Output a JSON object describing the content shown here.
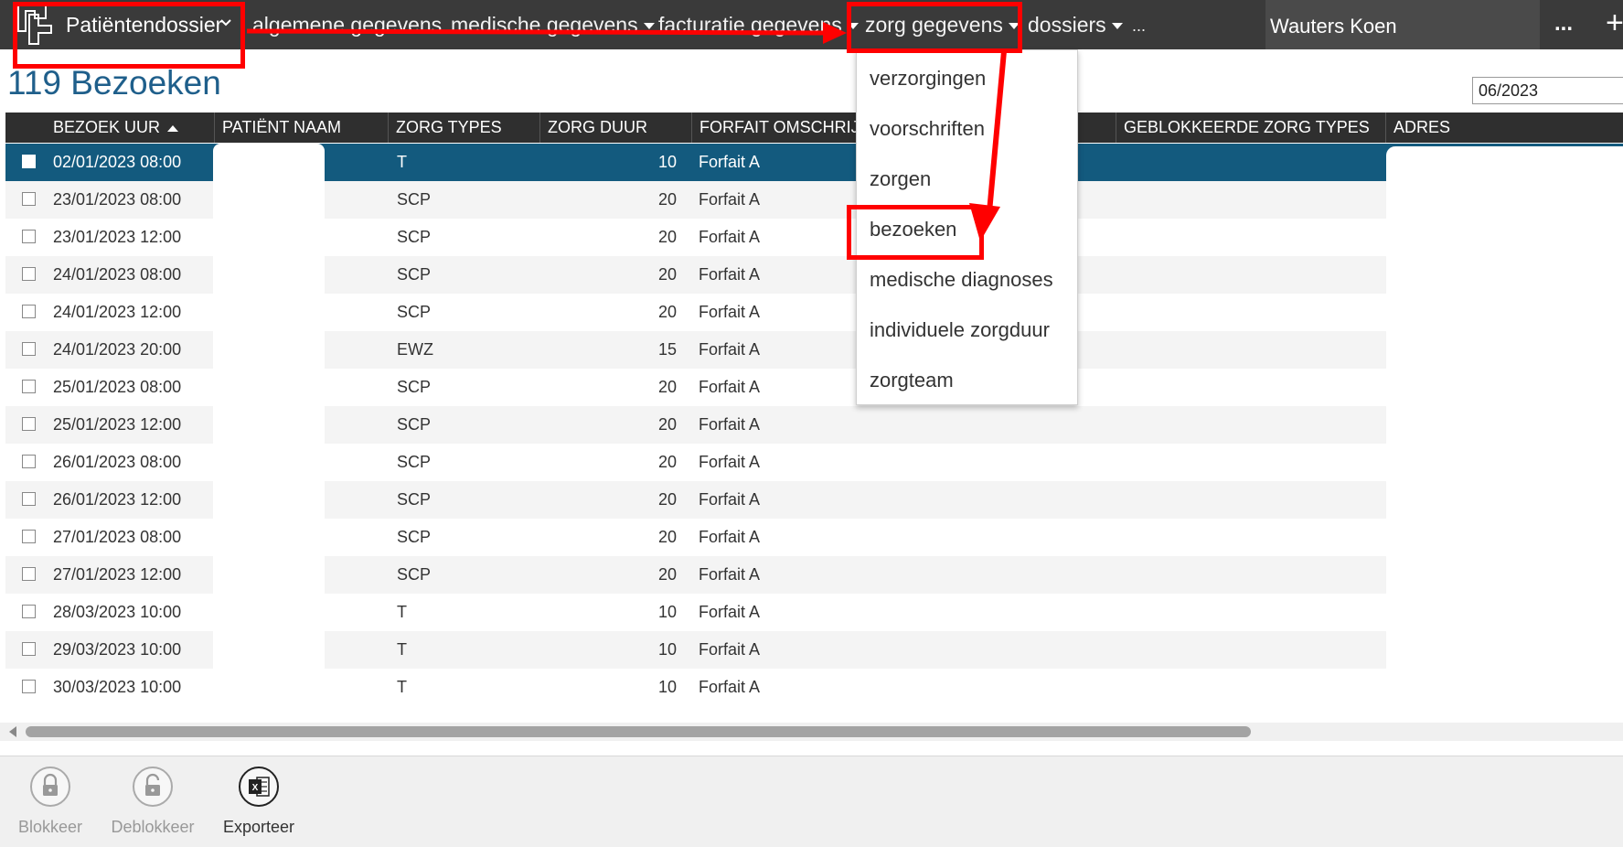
{
  "app": {
    "title": "Patiëntendossier"
  },
  "nav": [
    {
      "label": "algemene gegevens",
      "has_menu": false
    },
    {
      "label": "medische gegevens",
      "has_menu": true
    },
    {
      "label": "facturatie gegevens",
      "has_menu": true
    },
    {
      "label": "zorg gegevens",
      "has_menu": true
    },
    {
      "label": "dossiers",
      "has_menu": true
    },
    {
      "label": "...",
      "has_menu": false
    }
  ],
  "user": {
    "name": "Wauters Koen"
  },
  "header_actions": {
    "more": "...",
    "add": "+"
  },
  "page": {
    "title": "119 Bezoeken",
    "period_value": "06/2023"
  },
  "table": {
    "columns": [
      "BEZOEK UUR",
      "PATIËNT NAAM",
      "ZORG TYPES",
      "ZORG DUUR",
      "FORFAIT OMSCHRIJVI",
      "GEBLOKKEERDE ZORG TYPES",
      "ADRES"
    ],
    "sort_column": "BEZOEK UUR",
    "sort_direction": "asc",
    "rows": [
      {
        "datetime": "02/01/2023 08:00",
        "types": "T",
        "duration": "10",
        "forfait": "Forfait A",
        "selected": true
      },
      {
        "datetime": "23/01/2023 08:00",
        "types": "SCP",
        "duration": "20",
        "forfait": "Forfait A",
        "selected": false
      },
      {
        "datetime": "23/01/2023 12:00",
        "types": "SCP",
        "duration": "20",
        "forfait": "Forfait A",
        "selected": false
      },
      {
        "datetime": "24/01/2023 08:00",
        "types": "SCP",
        "duration": "20",
        "forfait": "Forfait A",
        "selected": false
      },
      {
        "datetime": "24/01/2023 12:00",
        "types": "SCP",
        "duration": "20",
        "forfait": "Forfait A",
        "selected": false
      },
      {
        "datetime": "24/01/2023 20:00",
        "types": "EWZ",
        "duration": "15",
        "forfait": "Forfait A",
        "selected": false
      },
      {
        "datetime": "25/01/2023 08:00",
        "types": "SCP",
        "duration": "20",
        "forfait": "Forfait A",
        "selected": false
      },
      {
        "datetime": "25/01/2023 12:00",
        "types": "SCP",
        "duration": "20",
        "forfait": "Forfait A",
        "selected": false
      },
      {
        "datetime": "26/01/2023 08:00",
        "types": "SCP",
        "duration": "20",
        "forfait": "Forfait A",
        "selected": false
      },
      {
        "datetime": "26/01/2023 12:00",
        "types": "SCP",
        "duration": "20",
        "forfait": "Forfait A",
        "selected": false
      },
      {
        "datetime": "27/01/2023 08:00",
        "types": "SCP",
        "duration": "20",
        "forfait": "Forfait A",
        "selected": false
      },
      {
        "datetime": "27/01/2023 12:00",
        "types": "SCP",
        "duration": "20",
        "forfait": "Forfait A",
        "selected": false
      },
      {
        "datetime": "28/03/2023 10:00",
        "types": "T",
        "duration": "10",
        "forfait": "Forfait A",
        "selected": false
      },
      {
        "datetime": "29/03/2023 10:00",
        "types": "T",
        "duration": "10",
        "forfait": "Forfait A",
        "selected": false
      },
      {
        "datetime": "30/03/2023 10:00",
        "types": "T",
        "duration": "10",
        "forfait": "Forfait A",
        "selected": false
      }
    ]
  },
  "dropdown": {
    "items": [
      "verzorgingen",
      "voorschriften",
      "zorgen",
      "bezoeken",
      "medische diagnoses",
      "individuele zorgduur",
      "zorgteam"
    ]
  },
  "toolbar": {
    "buttons": [
      {
        "label": "Blokkeer",
        "icon": "lock-icon",
        "enabled": false
      },
      {
        "label": "Deblokkeer",
        "icon": "unlock-icon",
        "enabled": false
      },
      {
        "label": "Exporteer",
        "icon": "excel-icon",
        "enabled": true
      }
    ]
  },
  "colors": {
    "topbar": "#3a3a3a",
    "title": "#1f5f8b",
    "selected_row": "#135a7e",
    "annotation": "#ff0000"
  }
}
